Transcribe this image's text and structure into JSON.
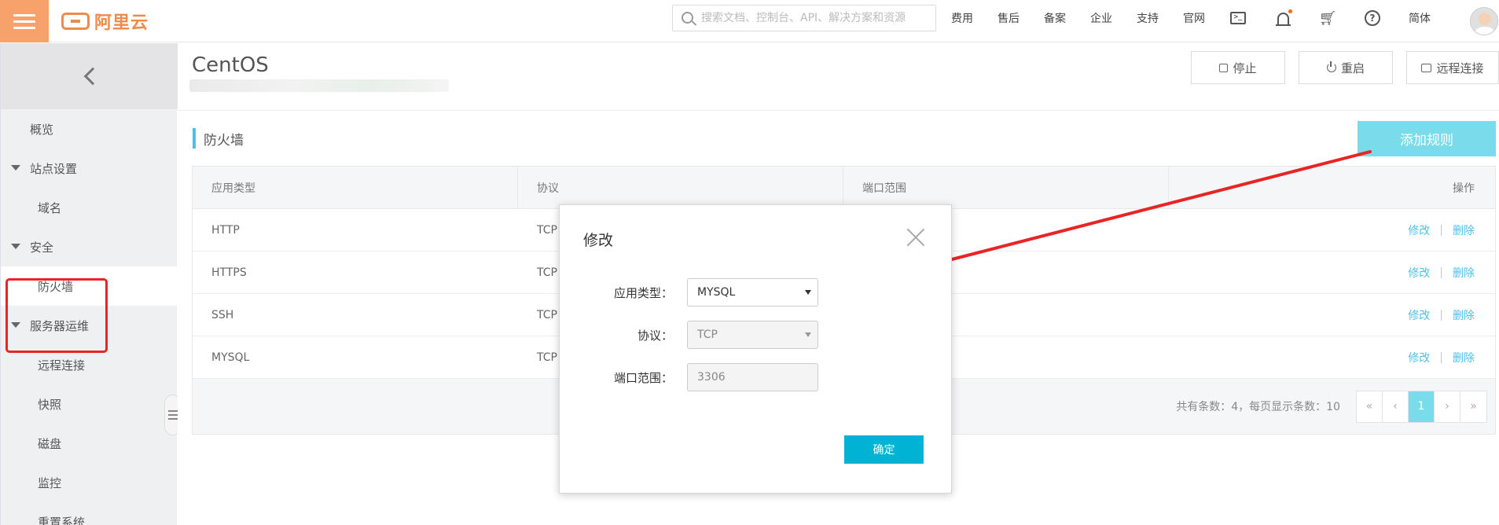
{
  "topbar": {
    "brand": "阿里云",
    "search_placeholder": "搜索文档、控制台、API、解决方案和资源",
    "nav": [
      "费用",
      "售后",
      "备案",
      "企业",
      "支持",
      "官网"
    ],
    "lang": "简体",
    "icons": [
      "terminal-icon",
      "bell-icon",
      "cart-icon",
      "help-icon"
    ]
  },
  "sidebar": {
    "items": [
      {
        "label": "概览"
      },
      {
        "label": "站点设置"
      },
      {
        "label": "域名"
      },
      {
        "label": "安全"
      },
      {
        "label": "防火墙"
      },
      {
        "label": "服务器运维"
      },
      {
        "label": "远程连接"
      },
      {
        "label": "快照"
      },
      {
        "label": "磁盘"
      },
      {
        "label": "监控"
      },
      {
        "label": "重置系统"
      }
    ]
  },
  "header": {
    "title": "CentOS",
    "buttons": {
      "stop": "停止",
      "restart": "重启",
      "remote": "远程连接"
    }
  },
  "firewall": {
    "section_title": "防火墙",
    "add_rule": "添加规则",
    "columns": [
      "应用类型",
      "协议",
      "端口范围",
      "操作"
    ],
    "rows": [
      {
        "type": "HTTP",
        "protocol": "TCP"
      },
      {
        "type": "HTTPS",
        "protocol": "TCP"
      },
      {
        "type": "SSH",
        "protocol": "TCP"
      },
      {
        "type": "MYSQL",
        "protocol": "TCP"
      }
    ],
    "edit_label": "修改",
    "delete_label": "删除",
    "total_text": "共有条数：4，每页显示条数：10",
    "pagination": {
      "first": "«",
      "prev": "‹",
      "current": "1",
      "next": "›",
      "last": "»"
    }
  },
  "modal": {
    "title": "修改",
    "fields": {
      "type_label": "应用类型：",
      "type_value": "MYSQL",
      "protocol_label": "协议：",
      "protocol_value": "TCP",
      "port_label": "端口范围：",
      "port_value": "3306"
    },
    "confirm": "确定"
  },
  "colors": {
    "accent": "#4fc0e8",
    "add_button": "#7adbea",
    "confirm_button": "#00b3d4",
    "brand_orange": "#f08a4b",
    "annotation_red": "#e92424"
  }
}
